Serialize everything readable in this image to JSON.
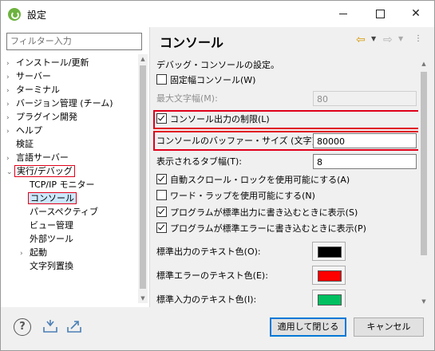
{
  "window": {
    "title": "設定"
  },
  "filter": {
    "placeholder": "フィルター入力"
  },
  "tree": {
    "items": [
      {
        "label": "インストール/更新",
        "arrow": "›"
      },
      {
        "label": "サーバー",
        "arrow": "›"
      },
      {
        "label": "ターミナル",
        "arrow": "›"
      },
      {
        "label": "バージョン管理 (チーム)",
        "arrow": "›"
      },
      {
        "label": "プラグイン開発",
        "arrow": "›"
      },
      {
        "label": "ヘルプ",
        "arrow": "›"
      },
      {
        "label": "検証",
        "arrow": ""
      },
      {
        "label": "言語サーバー",
        "arrow": "›"
      },
      {
        "label": "実行/デバッグ",
        "arrow": "⌄"
      },
      {
        "label": "TCP/IP モニター",
        "arrow": ""
      },
      {
        "label": "コンソール",
        "arrow": ""
      },
      {
        "label": "パースペクティブ",
        "arrow": ""
      },
      {
        "label": "ビュー管理",
        "arrow": ""
      },
      {
        "label": "外部ツール",
        "arrow": ""
      },
      {
        "label": "起動",
        "arrow": "›"
      },
      {
        "label": "文字列置換",
        "arrow": ""
      }
    ]
  },
  "page": {
    "title": "コンソール",
    "description": "デバッグ・コンソールの設定。",
    "fixed_width_label": "固定幅コンソール(W)",
    "fixed_width_checked": false,
    "max_chars_label": "最大文字幅(M):",
    "max_chars_value": "80",
    "limit_output_label": "コンソール出力の制限(L)",
    "limit_output_checked": true,
    "buffer_size_label": "コンソールのバッファー・サイズ (文字)(B):",
    "buffer_size_value": "80000",
    "tab_width_label": "表示されるタブ幅(T):",
    "tab_width_value": "8",
    "auto_scroll_label": "自動スクロール・ロックを使用可能にする(A)",
    "auto_scroll_checked": true,
    "word_wrap_label": "ワード・ラップを使用可能にする(N)",
    "word_wrap_checked": false,
    "show_on_stdout_label": "プログラムが標準出力に書き込むときに表示(S)",
    "show_on_stdout_checked": true,
    "show_on_stderr_label": "プログラムが標準エラーに書き込むときに表示(P)",
    "show_on_stderr_checked": true,
    "stdout_color_label": "標準出力のテキスト色(O):",
    "stdout_color": "#000000",
    "stderr_color_label": "標準エラーのテキスト色(E):",
    "stderr_color": "#ff0000",
    "stdin_color_label": "標準入力のテキスト色(I):",
    "stdin_color": "#00c060"
  },
  "buttons": {
    "apply_close": "適用して閉じる",
    "cancel": "キャンセル"
  },
  "colors": {
    "highlight_red": "#e0001a",
    "selection": "#cce8ff",
    "accent": "#0078d7"
  }
}
